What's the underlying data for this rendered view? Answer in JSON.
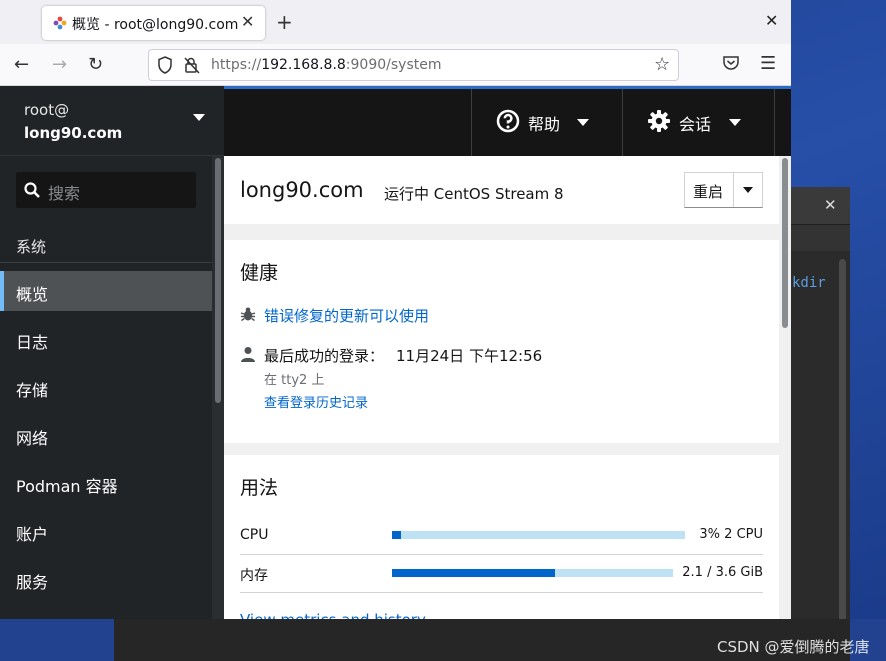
{
  "browser": {
    "tab_title": "概览 - root@long90.com",
    "url_prefix": "https://",
    "url_host": "192.168.8.8",
    "url_rest": ":9090/system"
  },
  "terminal": {
    "visible_text": "kdir"
  },
  "cockpit": {
    "host_user": "root@",
    "host_name": "long90.com",
    "help_label": "帮助",
    "session_label": "会话",
    "search_placeholder": "搜索",
    "nav_group": "系统",
    "nav_items": [
      {
        "label": "概览",
        "active": true
      },
      {
        "label": "日志"
      },
      {
        "label": "存储"
      },
      {
        "label": "网络"
      },
      {
        "label": "Podman 容器"
      },
      {
        "label": "账户"
      },
      {
        "label": "服务"
      }
    ],
    "page_host": "long90.com",
    "page_os": "运行中 CentOS Stream 8",
    "restart_label": "重启",
    "health": {
      "title": "健康",
      "updates_link": "错误修复的更新可以使用",
      "last_login_label": "最后成功的登录：",
      "last_login_value": "11月24日 下午12:56",
      "login_location": "在 tty2 上",
      "history_link": "查看登录历史记录"
    },
    "usage": {
      "title": "用法",
      "rows": [
        {
          "label": "CPU",
          "value": "3% 2 CPU",
          "fraction": 0.03
        },
        {
          "label": "内存",
          "value": "2.1 / 3.6 GiB",
          "fraction": 0.58
        }
      ],
      "metrics_link": "View metrics and history"
    }
  },
  "watermark": "CSDN @爱倒腾的老唐",
  "colors": {
    "accent": "#0066cc",
    "sidebar": "#212427",
    "topbar": "#151515",
    "active_indicator": "#73bcf7"
  }
}
